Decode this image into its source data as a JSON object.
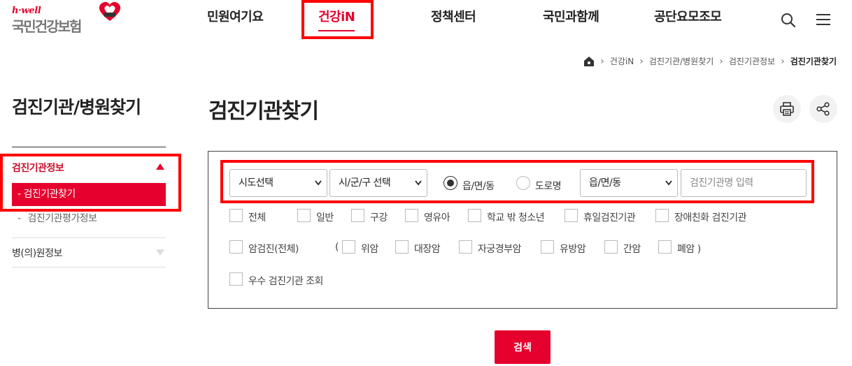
{
  "logo": {
    "brand": "h·well",
    "name": "국민건강보험"
  },
  "gnb": {
    "items": [
      "민원여기요",
      "건강iN",
      "정책센터",
      "국민과함께",
      "공단요모조모"
    ]
  },
  "breadcrumb": [
    "건강iN",
    "검진기관/병원찾기",
    "검진기관정보",
    "검진기관찾기"
  ],
  "lnb": {
    "title": "검진기관/병원찾기",
    "section1": "검진기관정보",
    "sub_active": "검진기관찾기",
    "sub2": "검진기관평가정보",
    "section2": "병(의)원정보"
  },
  "page_title": "검진기관찾기",
  "search": {
    "sido": "시도선택",
    "sigungu": "시/군/구 선택",
    "radio1": "읍/면/동",
    "radio2": "도로명",
    "dong": "읍/면/동",
    "name_placeholder": "검진기관명 입력"
  },
  "checks": {
    "row1": [
      "전체",
      "일반",
      "구강",
      "영유아",
      "학교 밖 청소년",
      "휴일검진기관",
      "장애친화 검진기관"
    ],
    "row2_lead": "암검진(전체)",
    "paren_open": "(",
    "row2": [
      "위암",
      "대장암",
      "자궁경부암",
      "유방암",
      "간암",
      "폐암 )"
    ],
    "row3": "우수 검진기관 조회"
  },
  "search_button": "검색",
  "colors": {
    "brand": "#e6002d",
    "highlight": "#ff0000"
  }
}
